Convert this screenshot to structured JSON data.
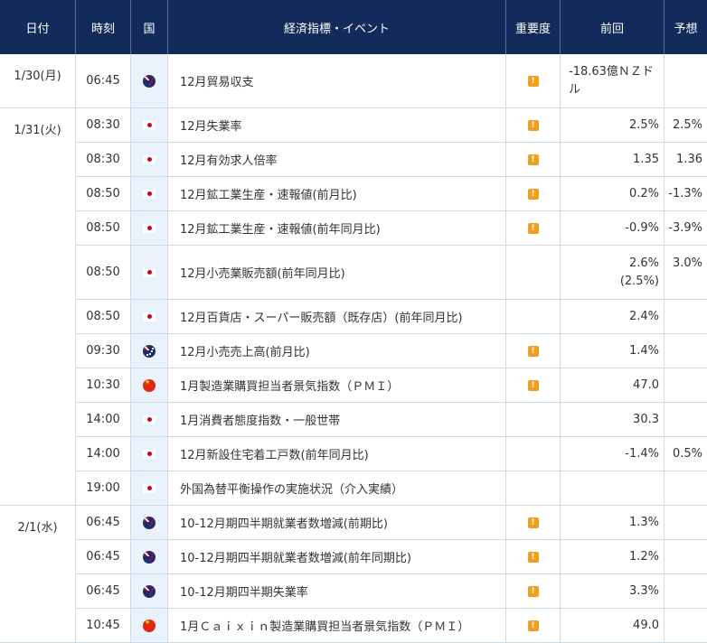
{
  "columns": {
    "date": "日付",
    "time": "時刻",
    "country": "国",
    "event": "経済指標・イベント",
    "importance": "重要度",
    "previous": "前回",
    "forecast": "予想"
  },
  "rows": [
    {
      "date": "1/30(月)",
      "time": "06:45",
      "flag": "nz-flag-icon",
      "event": "12月貿易収支",
      "important": true,
      "prev": "-18.63億ＮＺドル",
      "fcst": ""
    },
    {
      "date": "1/31(火)",
      "time": "08:30",
      "flag": "jp-flag-icon",
      "event": "12月失業率",
      "important": true,
      "prev": "2.5%",
      "fcst": "2.5%"
    },
    {
      "date": "",
      "time": "08:30",
      "flag": "jp-flag-icon",
      "event": "12月有効求人倍率",
      "important": true,
      "prev": "1.35",
      "fcst": "1.36"
    },
    {
      "date": "",
      "time": "08:50",
      "flag": "jp-flag-icon",
      "event": "12月鉱工業生産・速報値(前月比)",
      "important": true,
      "prev": "0.2%",
      "fcst": "-1.3%"
    },
    {
      "date": "",
      "time": "08:50",
      "flag": "jp-flag-icon",
      "event": "12月鉱工業生産・速報値(前年同月比)",
      "important": true,
      "prev": "-0.9%",
      "fcst": "-3.9%"
    },
    {
      "date": "",
      "time": "08:50",
      "flag": "jp-flag-icon",
      "event": "12月小売業販売額(前年同月比)",
      "important": false,
      "prev": "2.6%",
      "prev2": "(2.5%)",
      "fcst": "3.0%"
    },
    {
      "date": "",
      "time": "08:50",
      "flag": "jp-flag-icon",
      "event": "12月百貨店・スーパー販売額（既存店）(前年同月比)",
      "important": false,
      "prev": "2.4%",
      "fcst": ""
    },
    {
      "date": "",
      "time": "09:30",
      "flag": "au-flag-icon",
      "event": "12月小売売上高(前月比)",
      "important": true,
      "prev": "1.4%",
      "fcst": ""
    },
    {
      "date": "",
      "time": "10:30",
      "flag": "cn-flag-icon",
      "event": "1月製造業購買担当者景気指数（ＰＭＩ）",
      "important": true,
      "prev": "47.0",
      "fcst": ""
    },
    {
      "date": "",
      "time": "14:00",
      "flag": "jp-flag-icon",
      "event": "1月消費者態度指数・一般世帯",
      "important": false,
      "prev": "30.3",
      "fcst": ""
    },
    {
      "date": "",
      "time": "14:00",
      "flag": "jp-flag-icon",
      "event": "12月新設住宅着工戸数(前年同月比)",
      "important": false,
      "prev": "-1.4%",
      "fcst": "0.5%"
    },
    {
      "date": "",
      "time": "19:00",
      "flag": "jp-flag-icon",
      "event": "外国為替平衡操作の実施状況（介入実績）",
      "important": false,
      "prev": "",
      "fcst": ""
    },
    {
      "date": "2/1(水)",
      "time": "06:45",
      "flag": "nz-flag-icon",
      "event": "10-12月期四半期就業者数増減(前期比)",
      "important": true,
      "prev": "1.3%",
      "fcst": ""
    },
    {
      "date": "",
      "time": "06:45",
      "flag": "nz-flag-icon",
      "event": "10-12月期四半期就業者数増減(前年同期比)",
      "important": true,
      "prev": "1.2%",
      "fcst": ""
    },
    {
      "date": "",
      "time": "06:45",
      "flag": "nz-flag-icon",
      "event": "10-12月期四半期失業率",
      "important": true,
      "prev": "3.3%",
      "fcst": ""
    },
    {
      "date": "",
      "time": "10:45",
      "flag": "cn-flag-icon",
      "event": "1月Ｃａｉｘｉｎ製造業購買担当者景気指数（ＰＭＩ）",
      "important": true,
      "prev": "49.0",
      "fcst": ""
    }
  ],
  "importance_mark": "!"
}
